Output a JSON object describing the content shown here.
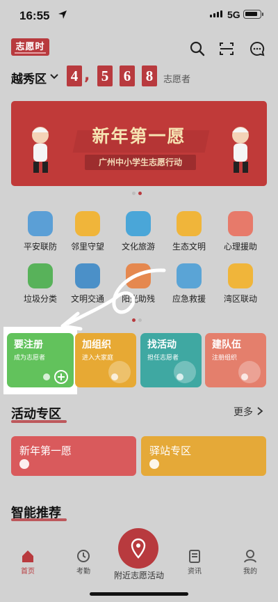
{
  "status_bar": {
    "time": "16:55",
    "network": "5G"
  },
  "header": {
    "logo_text": "志愿时",
    "icons": [
      "search-icon",
      "scan-icon",
      "message-icon"
    ]
  },
  "region": {
    "name": "越秀区",
    "digits": [
      "4",
      "5",
      "6",
      "8"
    ],
    "comma": ",",
    "suffix": "志愿者"
  },
  "banner": {
    "title": "新年第一愿",
    "subtitle": "广州中小学生志愿行动"
  },
  "services": [
    {
      "label": "平安联防",
      "icon": "shield-icon",
      "color": "#5b9fd6"
    },
    {
      "label": "邻里守望",
      "icon": "people-icon",
      "color": "#f0b53a"
    },
    {
      "label": "文化旅游",
      "icon": "plane-icon",
      "color": "#4aa6d8"
    },
    {
      "label": "生态文明",
      "icon": "planet-icon",
      "color": "#f0b53a"
    },
    {
      "label": "心理援助",
      "icon": "heart-icon",
      "color": "#e77a6a"
    },
    {
      "label": "垃圾分类",
      "icon": "recycle-icon",
      "color": "#58b25a"
    },
    {
      "label": "文明交通",
      "icon": "bus-icon",
      "color": "#4b90c8"
    },
    {
      "label": "阳光助残",
      "icon": "wheelchair-icon",
      "color": "#e5884f"
    },
    {
      "label": "应急救援",
      "icon": "first-aid-icon",
      "color": "#5aa4d6"
    },
    {
      "label": "湾区联动",
      "icon": "bridge-icon",
      "color": "#f0b53a"
    }
  ],
  "actions": [
    {
      "title": "要注册",
      "subtitle": "成为志愿者",
      "color": "#62c25c"
    },
    {
      "title": "加组织",
      "subtitle": "进入大家庭",
      "color": "#e7a934"
    },
    {
      "title": "找活动",
      "subtitle": "担任志愿者",
      "color": "#3fa8a2"
    },
    {
      "title": "建队伍",
      "subtitle": "注册组织",
      "color": "#e47f6c"
    }
  ],
  "activity_zone": {
    "title": "活动专区",
    "more": "更多",
    "cards": [
      {
        "title": "新年第一愿",
        "color": "#d95a5c"
      },
      {
        "title": "驿站专区",
        "color": "#e5a938"
      }
    ]
  },
  "recommend": {
    "title": "智能推荐"
  },
  "bottom_nav": [
    {
      "label": "首页",
      "icon": "home-icon"
    },
    {
      "label": "考勤",
      "icon": "attendance-icon"
    },
    {
      "label": "附近志愿活动",
      "icon": "location-pin-icon"
    },
    {
      "label": "资讯",
      "icon": "news-icon"
    },
    {
      "label": "我的",
      "icon": "profile-icon"
    }
  ]
}
